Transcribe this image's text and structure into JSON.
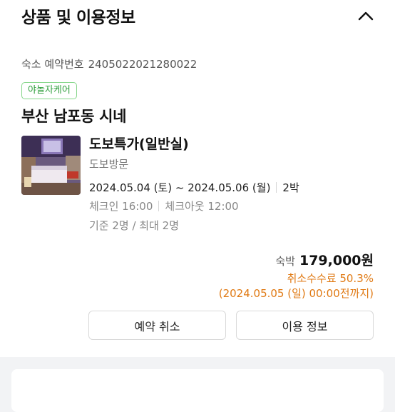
{
  "section": {
    "title": "상품 및 이용정보",
    "collapse_icon": "chevron-up-icon"
  },
  "booking": {
    "number_label": "숙소 예약번호",
    "number": "2405022021280022",
    "badge": "야놀자케어",
    "place_name": "부산 남포동 시네"
  },
  "room": {
    "name": "도보특가(일반실)",
    "visit_type": "도보방문",
    "dates": "2024.05.04 (토) ~ 2024.05.06 (월)",
    "nights": "2박",
    "check_in": "체크인 16:00",
    "check_out": "체크아웃 12:00",
    "occupancy": "기준 2명 / 최대 2명"
  },
  "payment": {
    "price_label": "숙박",
    "price": "179,000원",
    "cancel_fee": "취소수수료 50.3%",
    "cancel_deadline": "(2024.05.05 (일) 00:00전까지)"
  },
  "actions": {
    "cancel_label": "예약 취소",
    "info_label": "이용 정보"
  },
  "colors": {
    "badge_green": "#2e9e3b",
    "fee_orange": "#e07a14"
  }
}
